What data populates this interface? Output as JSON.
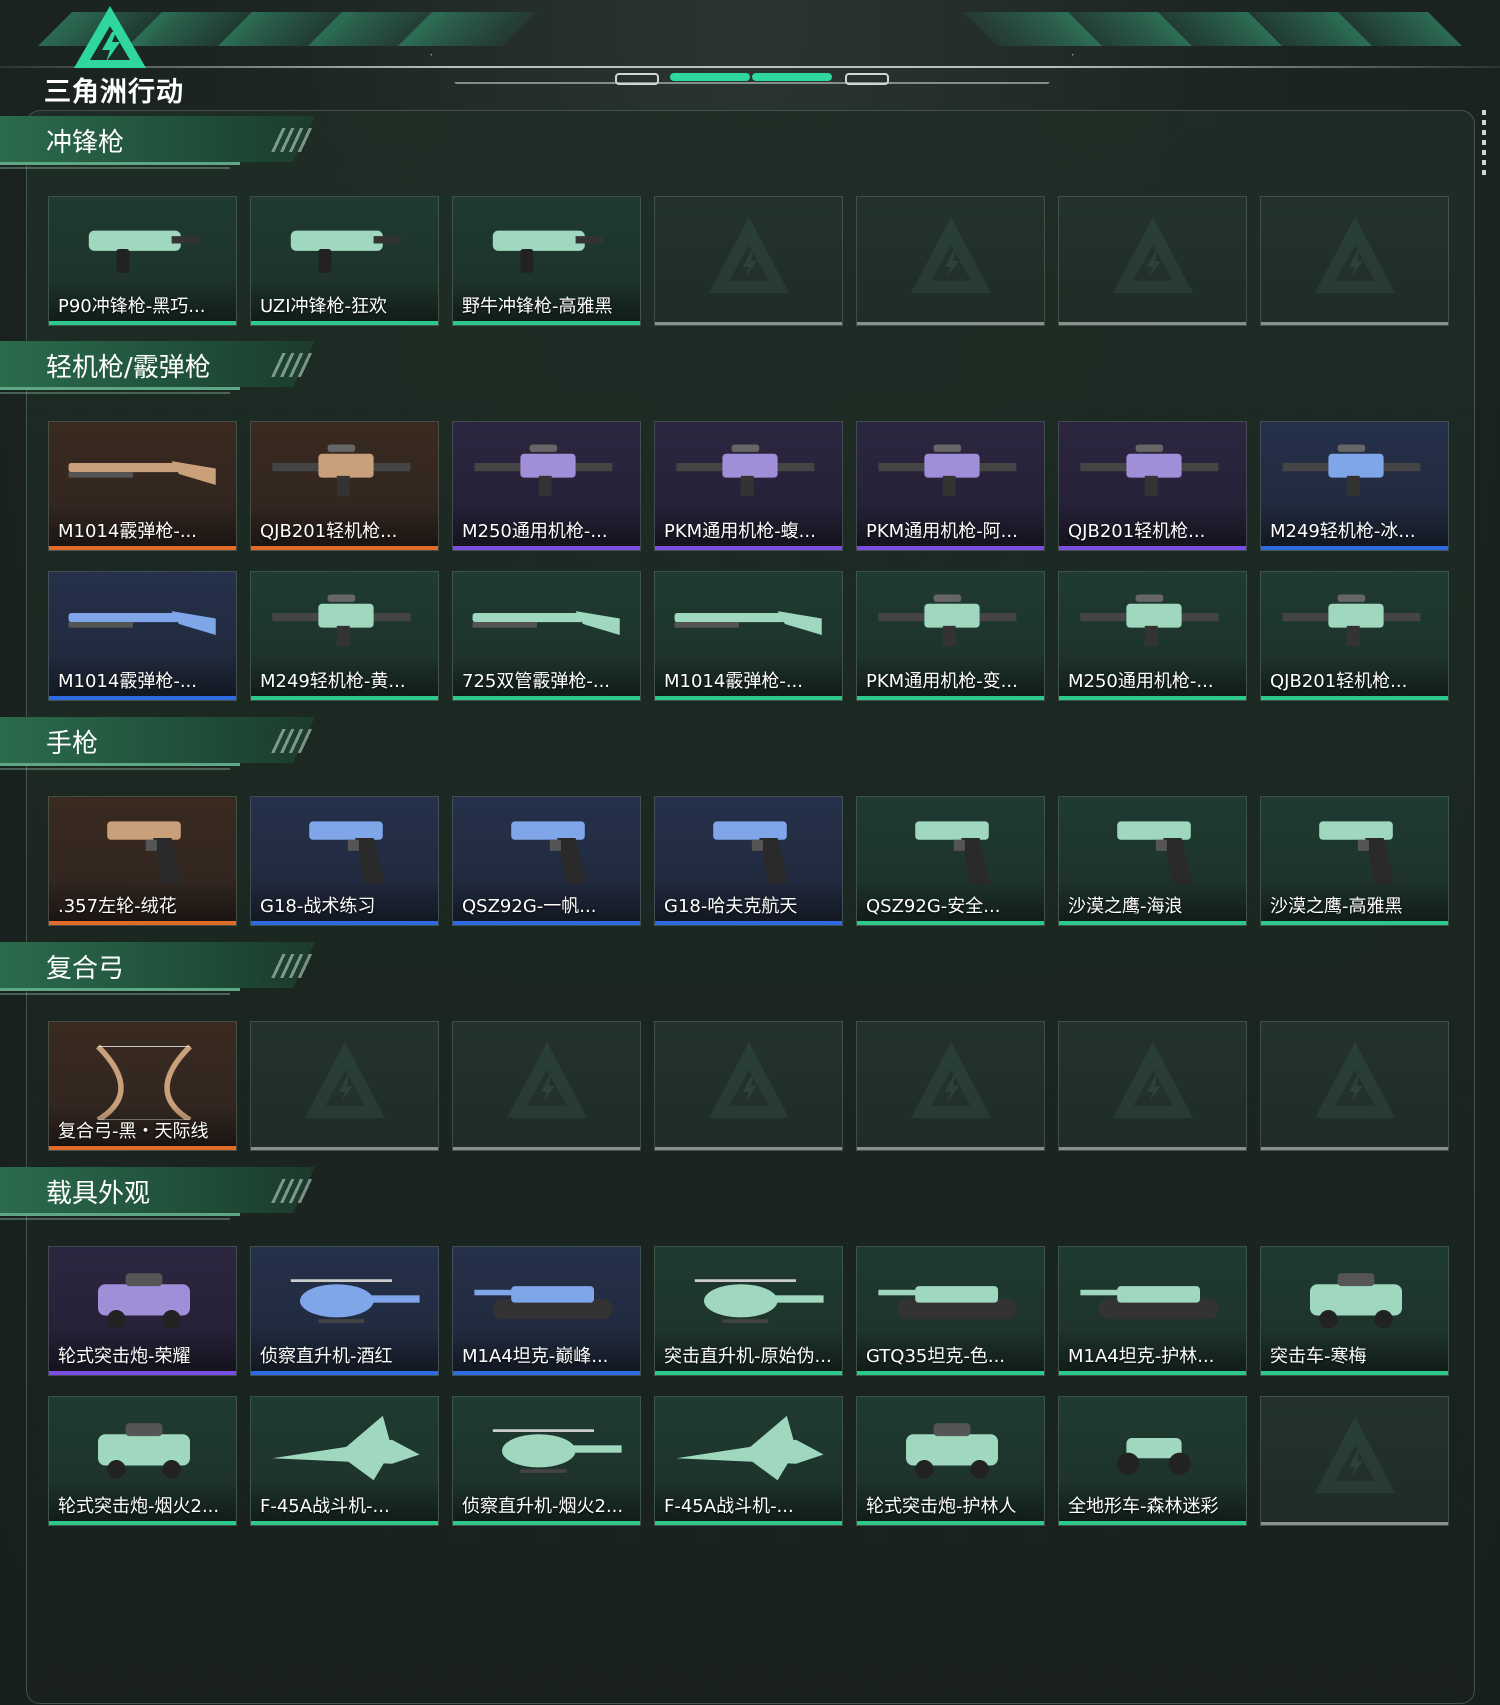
{
  "app": {
    "logo_text": "三角洲行动"
  },
  "colors": {
    "orange": "#e06b2b",
    "purple": "#7a4ee0",
    "blue": "#2f6be0",
    "green": "#2ec98a",
    "empty": "#8a918d",
    "accent": "#2fd6a0"
  },
  "sections": [
    {
      "title": "冲锋枪",
      "items": [
        {
          "label": "P90冲锋枪-黑巧...",
          "rarity": "green",
          "icon": "smg-icon"
        },
        {
          "label": "UZI冲锋枪-狂欢",
          "rarity": "green",
          "icon": "smg-icon"
        },
        {
          "label": "野牛冲锋枪-高雅黑",
          "rarity": "green",
          "icon": "smg-icon"
        },
        {
          "label": "",
          "rarity": "empty"
        },
        {
          "label": "",
          "rarity": "empty"
        },
        {
          "label": "",
          "rarity": "empty"
        },
        {
          "label": "",
          "rarity": "empty"
        }
      ]
    },
    {
      "title": "轻机枪/霰弹枪",
      "items": [
        {
          "label": "M1014霰弹枪-...",
          "rarity": "orange",
          "icon": "shotgun-icon"
        },
        {
          "label": "QJB201轻机枪...",
          "rarity": "orange",
          "icon": "lmg-icon"
        },
        {
          "label": "M250通用机枪-...",
          "rarity": "purple",
          "icon": "lmg-icon"
        },
        {
          "label": "PKM通用机枪-蝮...",
          "rarity": "purple",
          "icon": "lmg-icon"
        },
        {
          "label": "PKM通用机枪-阿...",
          "rarity": "purple",
          "icon": "lmg-icon"
        },
        {
          "label": "QJB201轻机枪...",
          "rarity": "purple",
          "icon": "lmg-icon"
        },
        {
          "label": "M249轻机枪-冰...",
          "rarity": "blue",
          "icon": "lmg-icon"
        },
        {
          "label": "M1014霰弹枪-...",
          "rarity": "blue",
          "icon": "shotgun-icon"
        },
        {
          "label": "M249轻机枪-黄...",
          "rarity": "green",
          "icon": "lmg-icon"
        },
        {
          "label": "725双管霰弹枪-...",
          "rarity": "green",
          "icon": "shotgun-icon"
        },
        {
          "label": "M1014霰弹枪-...",
          "rarity": "green",
          "icon": "shotgun-icon"
        },
        {
          "label": "PKM通用机枪-变...",
          "rarity": "green",
          "icon": "lmg-icon"
        },
        {
          "label": "M250通用机枪-...",
          "rarity": "green",
          "icon": "lmg-icon"
        },
        {
          "label": "QJB201轻机枪...",
          "rarity": "green",
          "icon": "lmg-icon"
        }
      ]
    },
    {
      "title": "手枪",
      "items": [
        {
          "label": ".357左轮-绒花",
          "rarity": "orange",
          "icon": "pistol-icon"
        },
        {
          "label": "G18-战术练习",
          "rarity": "blue",
          "icon": "pistol-icon"
        },
        {
          "label": "QSZ92G-一帆...",
          "rarity": "blue",
          "icon": "pistol-icon"
        },
        {
          "label": "G18-哈夫克航天",
          "rarity": "blue",
          "icon": "pistol-icon"
        },
        {
          "label": "QSZ92G-安全...",
          "rarity": "green",
          "icon": "pistol-icon"
        },
        {
          "label": "沙漠之鹰-海浪",
          "rarity": "green",
          "icon": "pistol-icon"
        },
        {
          "label": "沙漠之鹰-高雅黑",
          "rarity": "green",
          "icon": "pistol-icon"
        }
      ]
    },
    {
      "title": "复合弓",
      "items": [
        {
          "label": "复合弓-黑・天际线",
          "rarity": "orange",
          "icon": "bow-icon"
        },
        {
          "label": "",
          "rarity": "empty"
        },
        {
          "label": "",
          "rarity": "empty"
        },
        {
          "label": "",
          "rarity": "empty"
        },
        {
          "label": "",
          "rarity": "empty"
        },
        {
          "label": "",
          "rarity": "empty"
        },
        {
          "label": "",
          "rarity": "empty"
        }
      ]
    },
    {
      "title": "载具外观",
      "items": [
        {
          "label": "轮式突击炮-荣耀",
          "rarity": "purple",
          "icon": "armored-car-icon"
        },
        {
          "label": "侦察直升机-酒红",
          "rarity": "blue",
          "icon": "helicopter-icon"
        },
        {
          "label": "M1A4坦克-巅峰...",
          "rarity": "blue",
          "icon": "tank-icon"
        },
        {
          "label": "突击直升机-原始伪...",
          "rarity": "green",
          "icon": "helicopter-icon"
        },
        {
          "label": "GTQ35坦克-色...",
          "rarity": "green",
          "icon": "tank-icon"
        },
        {
          "label": "M1A4坦克-护林...",
          "rarity": "green",
          "icon": "tank-icon"
        },
        {
          "label": "突击车-寒梅",
          "rarity": "green",
          "icon": "armored-car-icon"
        },
        {
          "label": "轮式突击炮-烟火2...",
          "rarity": "green",
          "icon": "armored-car-icon"
        },
        {
          "label": "F-45A战斗机-...",
          "rarity": "green",
          "icon": "jet-icon"
        },
        {
          "label": "侦察直升机-烟火2...",
          "rarity": "green",
          "icon": "helicopter-icon"
        },
        {
          "label": "F-45A战斗机-...",
          "rarity": "green",
          "icon": "jet-icon"
        },
        {
          "label": "轮式突击炮-护林人",
          "rarity": "green",
          "icon": "armored-car-icon"
        },
        {
          "label": "全地形车-森林迷彩",
          "rarity": "green",
          "icon": "atv-icon"
        },
        {
          "label": "",
          "rarity": "empty"
        }
      ]
    }
  ]
}
